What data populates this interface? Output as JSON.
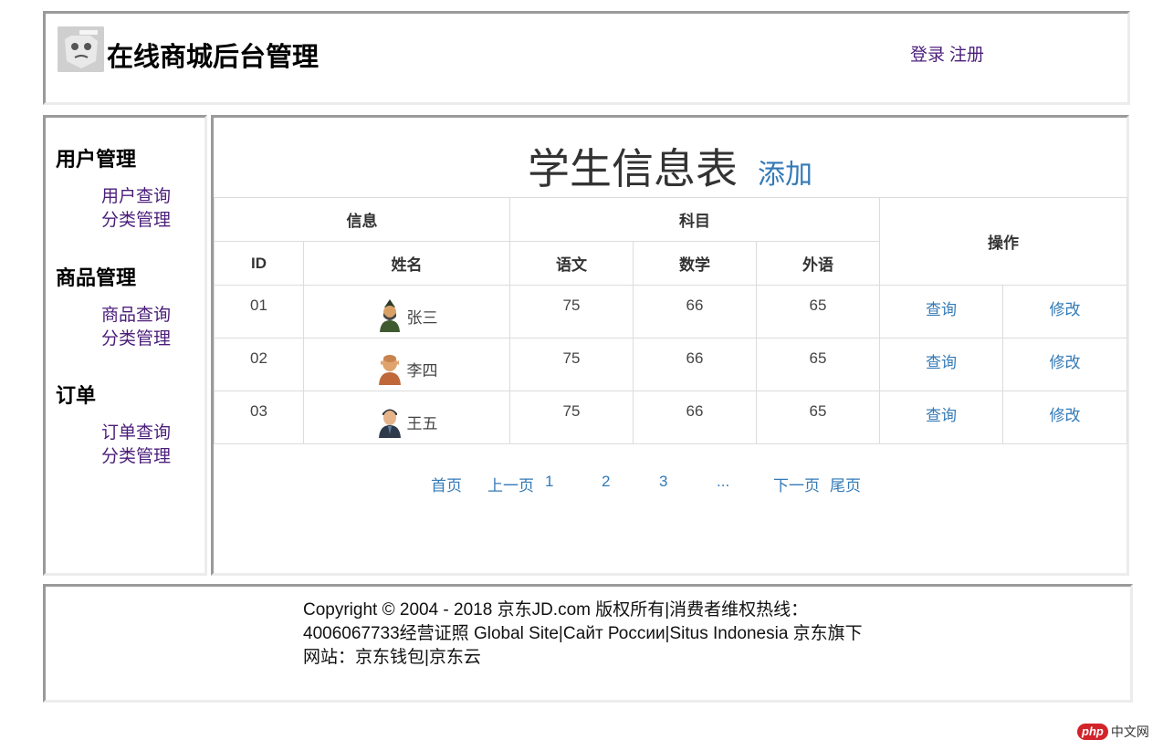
{
  "header": {
    "title": "在线商城后台管理",
    "login": "登录",
    "register": "注册"
  },
  "sidebar": {
    "sections": [
      {
        "title": "用户管理",
        "links": [
          "用户查询",
          "分类管理"
        ]
      },
      {
        "title": "商品管理",
        "links": [
          "商品查询",
          "分类管理"
        ]
      },
      {
        "title": "订单",
        "links": [
          "订单查询",
          "分类管理"
        ]
      }
    ]
  },
  "main": {
    "title": "学生信息表",
    "add_label": "添加",
    "group_headers": {
      "info": "信息",
      "subjects": "科目",
      "actions": "操作"
    },
    "columns": [
      "ID",
      "姓名",
      "语文",
      "数学",
      "外语"
    ],
    "rows": [
      {
        "id": "01",
        "name": "张三",
        "chinese": "75",
        "math": "66",
        "english": "65",
        "query": "查询",
        "edit": "修改"
      },
      {
        "id": "02",
        "name": "李四",
        "chinese": "75",
        "math": "66",
        "english": "65",
        "query": "查询",
        "edit": "修改"
      },
      {
        "id": "03",
        "name": "王五",
        "chinese": "75",
        "math": "66",
        "english": "65",
        "query": "查询",
        "edit": "修改"
      }
    ],
    "pager": {
      "first": "首页",
      "prev": "上一页",
      "p1": "1",
      "p2": "2",
      "p3": "3",
      "ellipsis": "...",
      "next": "下一页",
      "last": "尾页"
    }
  },
  "footer": {
    "copyright": "Copyright © 2004 - 2018 京东JD.com 版权所有|消费者维权热线：4006067733经营证照 Global Site|Сайт России|Situs Indonesia 京东旗下网站：京东钱包|京东云"
  },
  "watermark": {
    "brand": "php",
    "text": "中文网"
  },
  "colors": {
    "link_blue": "#337ab7",
    "nav_purple": "#4b1e7a",
    "border_dark": "#9a9a9a",
    "border_light": "#ececec"
  }
}
